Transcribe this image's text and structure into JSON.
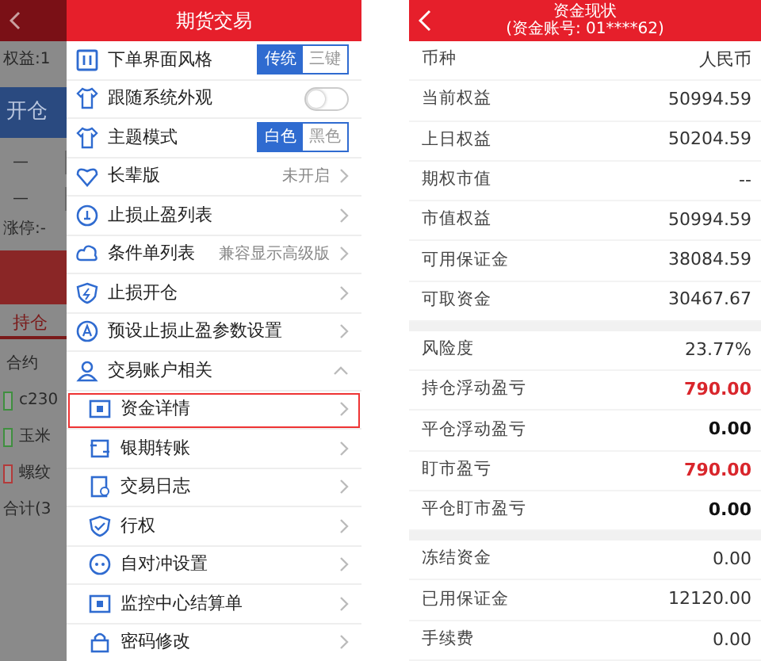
{
  "left_screen": {
    "background_app": {
      "balance": "权益:1",
      "open_button": "开仓",
      "fields": [
        "—",
        "—"
      ],
      "limit": "涨停:-",
      "position_tab": "持仓",
      "column_header": "合约",
      "contracts": [
        {
          "name": "c230",
          "color": "#3f8f3f"
        },
        {
          "name": "玉米",
          "color": "#3f8f3f"
        },
        {
          "name": "螺纹",
          "color": "#b33a3a"
        }
      ],
      "total": "合计(3"
    },
    "drawer": {
      "title": "期货交易",
      "items": [
        {
          "kind": "segmented",
          "label": "下单界面风格",
          "options": [
            {
              "label": "传统",
              "selected": true
            },
            {
              "label": "三键",
              "selected": false
            }
          ]
        },
        {
          "kind": "toggle",
          "label": "跟随系统外观",
          "on": false
        },
        {
          "kind": "segmented",
          "label": "主题模式",
          "options": [
            {
              "label": "白色",
              "selected": true
            },
            {
              "label": "黑色",
              "selected": false
            }
          ]
        },
        {
          "kind": "link",
          "label": "长辈版",
          "value": "未开启"
        },
        {
          "kind": "link",
          "label": "止损止盈列表"
        },
        {
          "kind": "link",
          "label": "条件单列表",
          "value": "兼容显示高级版"
        },
        {
          "kind": "link",
          "label": "止损开仓"
        },
        {
          "kind": "link",
          "label": "预设止损止盈参数设置"
        },
        {
          "kind": "section",
          "label": "交易账户相关",
          "expanded": true,
          "children": [
            {
              "label": "资金详情",
              "highlighted": true
            },
            {
              "label": "银期转账",
              "highlighted": false
            },
            {
              "label": "交易日志",
              "highlighted": false
            },
            {
              "label": "行权",
              "highlighted": false
            },
            {
              "label": "自对冲设置",
              "highlighted": false
            },
            {
              "label": "监控中心结算单",
              "highlighted": false
            },
            {
              "label": "密码修改",
              "highlighted": false
            }
          ]
        }
      ]
    }
  },
  "right_screen": {
    "title": "资金现状",
    "subtitle": "(资金账号: 01****62)",
    "groups": [
      [
        {
          "label": "币种",
          "value": "人民币",
          "kind": "plain"
        },
        {
          "label": "当前权益",
          "value": "50994.59",
          "kind": "plain"
        },
        {
          "label": "上日权益",
          "value": "50204.59",
          "kind": "plain"
        },
        {
          "label": "期权市值",
          "value": "--",
          "kind": "plain"
        },
        {
          "label": "市值权益",
          "value": "50994.59",
          "kind": "plain"
        },
        {
          "label": "可用保证金",
          "value": "38084.59",
          "kind": "plain"
        },
        {
          "label": "可取资金",
          "value": "30467.67",
          "kind": "plain"
        }
      ],
      [
        {
          "label": "风险度",
          "value": "23.77%",
          "kind": "plain"
        },
        {
          "label": "持仓浮动盈亏",
          "value": "790.00",
          "kind": "profit"
        },
        {
          "label": "平仓浮动盈亏",
          "value": "0.00",
          "kind": "bold"
        },
        {
          "label": "盯市盈亏",
          "value": "790.00",
          "kind": "profit"
        },
        {
          "label": "平仓盯市盈亏",
          "value": "0.00",
          "kind": "bold"
        }
      ],
      [
        {
          "label": "冻结资金",
          "value": "0.00",
          "kind": "plain"
        },
        {
          "label": "已用保证金",
          "value": "12120.00",
          "kind": "plain"
        },
        {
          "label": "手续费",
          "value": "0.00",
          "kind": "plain"
        }
      ]
    ]
  }
}
